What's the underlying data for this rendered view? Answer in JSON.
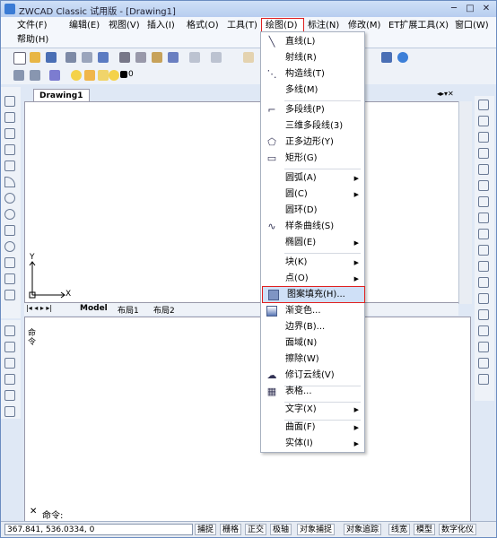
{
  "window": {
    "title": "ZWCAD Classic 试用版 - [Drawing1]"
  },
  "menubar": {
    "items": [
      {
        "label": "文件(F)"
      },
      {
        "label": "编辑(E)"
      },
      {
        "label": "视图(V)"
      },
      {
        "label": "插入(I)"
      },
      {
        "label": "格式(O)"
      },
      {
        "label": "工具(T)"
      },
      {
        "label": "绘图(D)"
      },
      {
        "label": "标注(N)"
      },
      {
        "label": "修改(M)"
      },
      {
        "label": "ET扩展工具(X)"
      },
      {
        "label": "窗口(W)"
      }
    ],
    "help": "帮助(H)"
  },
  "layer_toolbar": {
    "layer_value": "0"
  },
  "drawing_tab": "Drawing1",
  "canvas": {
    "axis_x": "X",
    "axis_y": "Y"
  },
  "layout_tabs": [
    {
      "label": "Model"
    },
    {
      "label": "布局1"
    },
    {
      "label": "布局2"
    }
  ],
  "side_panel_label": "命令",
  "command": {
    "prompt": "命令:"
  },
  "draw_menu": {
    "items": [
      {
        "label": "直线(L)",
        "icon": "line-icon"
      },
      {
        "label": "射线(R)",
        "icon": ""
      },
      {
        "label": "构造线(T)",
        "icon": "construction-line-icon"
      },
      {
        "label": "多线(M)",
        "icon": ""
      },
      {
        "label": "多段线(P)",
        "icon": "polyline-icon"
      },
      {
        "label": "三维多段线(3)",
        "icon": ""
      },
      {
        "label": "正多边形(Y)",
        "icon": "polygon-icon"
      },
      {
        "label": "矩形(G)",
        "icon": "rectangle-icon"
      },
      {
        "label": "圆弧(A)",
        "icon": "",
        "submenu": true
      },
      {
        "label": "圆(C)",
        "icon": "",
        "submenu": true
      },
      {
        "label": "圆环(D)",
        "icon": ""
      },
      {
        "label": "样条曲线(S)",
        "icon": "spline-icon"
      },
      {
        "label": "椭圆(E)",
        "icon": "",
        "submenu": true
      },
      {
        "label": "块(K)",
        "icon": "",
        "submenu": true
      },
      {
        "label": "点(O)",
        "icon": "",
        "submenu": true
      },
      {
        "label": "图案填充(H)...",
        "icon": "hatch-icon"
      },
      {
        "label": "渐变色...",
        "icon": "gradient-icon"
      },
      {
        "label": "边界(B)...",
        "icon": ""
      },
      {
        "label": "面域(N)",
        "icon": ""
      },
      {
        "label": "擦除(W)",
        "icon": ""
      },
      {
        "label": "修订云线(V)",
        "icon": "revcloud-icon"
      },
      {
        "label": "表格...",
        "icon": "table-icon"
      },
      {
        "label": "文字(X)",
        "icon": "",
        "submenu": true
      },
      {
        "label": "曲面(F)",
        "icon": "",
        "submenu": true
      },
      {
        "label": "实体(I)",
        "icon": "",
        "submenu": true
      }
    ]
  },
  "statusbar": {
    "coords": "367.841,  536.0334,  0",
    "buttons": [
      {
        "label": "捕捉"
      },
      {
        "label": "栅格"
      },
      {
        "label": "正交"
      },
      {
        "label": "极轴"
      },
      {
        "label": "对象捕捉"
      },
      {
        "label": "对象追踪"
      },
      {
        "label": "线宽"
      },
      {
        "label": "模型"
      },
      {
        "label": "数字化仪"
      }
    ]
  },
  "colors": {
    "highlight_border": "#e02020",
    "menu_hover": "#cfe0f7",
    "titlebar": "#b7cdef"
  }
}
